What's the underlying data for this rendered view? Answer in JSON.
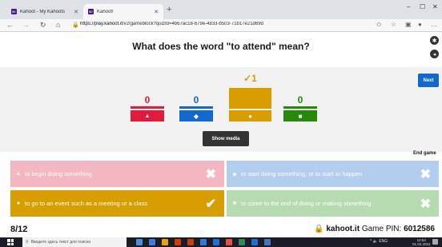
{
  "browser": {
    "tabs": [
      {
        "label": "Kahoot - My Kahoots",
        "icon": "kahoot-favicon"
      },
      {
        "label": "Kahoot!",
        "icon": "kahoot-favicon"
      }
    ],
    "new_tab": "+",
    "win_minimize": "–",
    "win_maximize": "☐",
    "win_close": "✕",
    "url_host": "https://play.kahoot.it",
    "url_path": "/v2/gameblock?quizId=4b67ac18-679e-4833-b503-71b17e21d69d",
    "back": "←",
    "forward": "→",
    "reload": "↻",
    "home": "⌂"
  },
  "question": "What does the word \"to attend\" mean?",
  "next_label": "Next",
  "show_media_label": "Show media",
  "end_game_label": "End game",
  "results": {
    "counts": [
      "0",
      "0",
      "✓1",
      "0"
    ],
    "colors": [
      "#e21b3c",
      "#1368ce",
      "#d89e00",
      "#26890c"
    ],
    "shapes": [
      "▲",
      "◆",
      "●",
      "■"
    ]
  },
  "answers": [
    {
      "shape": "▲",
      "text": "to begin doing something",
      "mark": "✖",
      "correct": false,
      "color": "#f4b6c1"
    },
    {
      "shape": "◆",
      "text": "to start doing something, or to start to happen",
      "mark": "✖",
      "correct": false,
      "color": "#b3cdef"
    },
    {
      "shape": "●",
      "text": "to go to an event such as a meeting or a class",
      "mark": "✔",
      "correct": true,
      "color": "#d89e00"
    },
    {
      "shape": "■",
      "text": "to come to the end of doing or making something",
      "mark": "✖",
      "correct": false,
      "color": "#b6dbb0"
    }
  ],
  "footer": {
    "page": "8/12",
    "site": "kahoot.it",
    "pin_label": "Game PIN:",
    "pin": "6012586"
  },
  "taskbar": {
    "search_placeholder": "Введите здесь текст для поиска",
    "tray": "^ 🔈 ENG",
    "time": "12:54",
    "date": "01.02.2022"
  }
}
